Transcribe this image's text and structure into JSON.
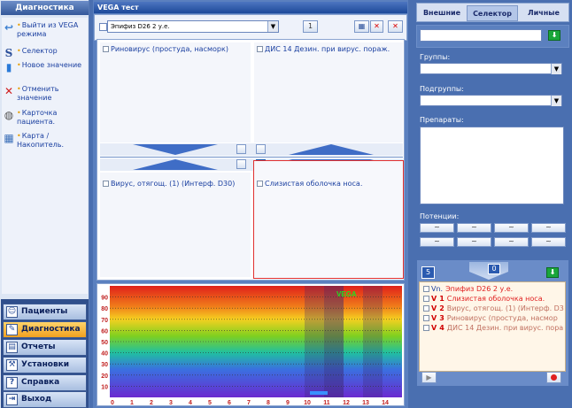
{
  "left_panel": {
    "title": "Диагностика",
    "actions": [
      {
        "label": "Выйти из VEGA режима",
        "icon": "exit-icon"
      },
      {
        "label": "Селектор",
        "icon": "selector-icon"
      },
      {
        "label": "Новое значение",
        "icon": "new-value-icon"
      },
      {
        "label": "Отменить значение",
        "icon": "cancel-value-icon"
      },
      {
        "label": "Карточка пациента.",
        "icon": "patient-card-icon"
      },
      {
        "label": "Карта / Накопитель.",
        "icon": "map-storage-icon"
      }
    ],
    "nav": [
      {
        "label": "Пациенты",
        "icon": "patients-icon",
        "active": false
      },
      {
        "label": "Диагностика",
        "icon": "diagnostics-icon",
        "active": true
      },
      {
        "label": "Отчеты",
        "icon": "reports-icon",
        "active": false
      },
      {
        "label": "Установки",
        "icon": "settings-icon",
        "active": false
      },
      {
        "label": "Справка",
        "icon": "help-icon",
        "active": false
      },
      {
        "label": "Выход",
        "icon": "exit-door-icon",
        "active": false
      }
    ]
  },
  "main": {
    "title": "VEGA тест",
    "toolbar": {
      "preparation_value": "Эпифиз D26 2 у.е.",
      "count_value": "1"
    },
    "cells": [
      {
        "label": "Риновирус (простуда, насморк)"
      },
      {
        "label": "ДИС 14 Дезин. при вирус. пораж."
      },
      {
        "label": "Вирус, отягощ. (1) (Интерф. D30)"
      },
      {
        "label": "Слизистая оболочка носа."
      }
    ]
  },
  "chart_data": {
    "type": "heatmap",
    "title": "VEGA",
    "x_ticks": [
      "0",
      "1",
      "2",
      "3",
      "4",
      "5",
      "6",
      "7",
      "8",
      "9",
      "10",
      "11",
      "12",
      "13",
      "14"
    ],
    "y_ticks": [
      "90",
      "80",
      "70",
      "60",
      "50",
      "40",
      "30",
      "20",
      "10"
    ],
    "ylim": [
      0,
      100
    ],
    "highlight_columns": [
      10,
      11,
      13
    ]
  },
  "right_panel": {
    "tabs": [
      {
        "label": "Внешние",
        "active": false
      },
      {
        "label": "Селектор",
        "active": true
      },
      {
        "label": "Личные",
        "active": false
      }
    ],
    "groups_label": "Группы:",
    "subgroups_label": "Подгруппы:",
    "preparations_label": "Препараты:",
    "potencies_label": "Потенции:",
    "potency_buttons": [
      "~",
      "~",
      "~",
      "~",
      "~",
      "~",
      "~",
      "~"
    ],
    "counter_left": "5",
    "counter_center": "0",
    "tree_rows": [
      {
        "tag": "Vn.",
        "num": "",
        "text": "Эпифиз D26 2 у.е.",
        "muted": false
      },
      {
        "tag": "V",
        "num": "1",
        "text": "Слизистая оболочка носа.",
        "muted": false
      },
      {
        "tag": "V",
        "num": "2",
        "text": "Вирус, отягощ. (1) (Интерф. D3",
        "muted": true
      },
      {
        "tag": "V",
        "num": "3",
        "text": "Риновирус (простуда, насмор",
        "muted": true
      },
      {
        "tag": "V",
        "num": "4",
        "text": "ДИС 14 Дезин. при вирус. пора",
        "muted": true
      }
    ]
  }
}
